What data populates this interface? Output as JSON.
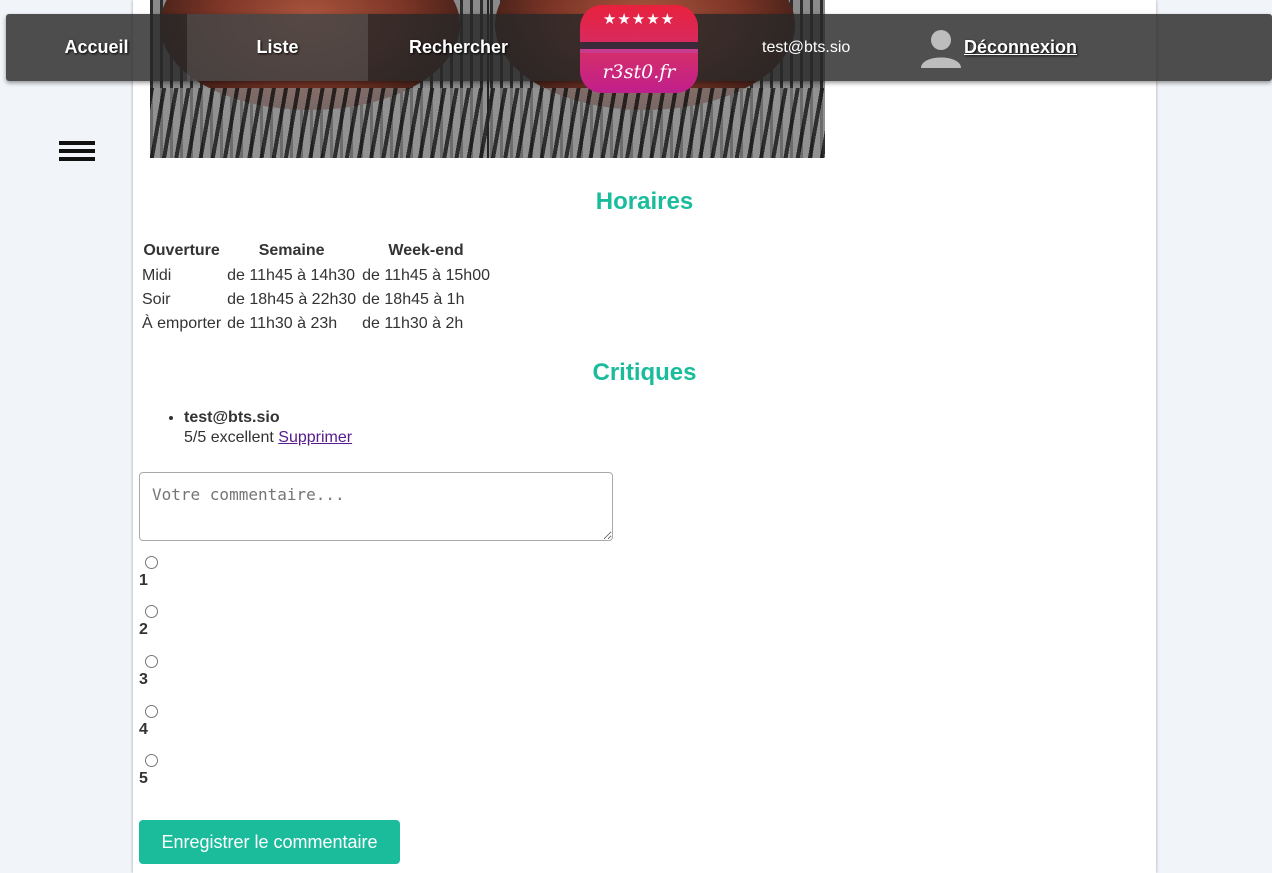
{
  "nav": {
    "home": "Accueil",
    "list": "Liste",
    "search": "Rechercher",
    "logo_stars": "★★★★★",
    "logo_text": "r3st0.fr",
    "user_email": "test@bts.sio",
    "logout": "Déconnexion"
  },
  "hours": {
    "title": "Horaires",
    "headers": [
      "Ouverture",
      "Semaine",
      "Week-end"
    ],
    "rows": [
      [
        "Midi",
        "de 11h45 à 14h30",
        "de 11h45 à 15h00"
      ],
      [
        "Soir",
        "de 18h45 à 22h30",
        "de 18h45 à 1h"
      ],
      [
        "À emporter",
        "de 11h30 à 23h",
        "de 11h30 à 2h"
      ]
    ]
  },
  "reviews": {
    "title": "Critiques",
    "items": [
      {
        "author": "test@bts.sio",
        "text": "5/5 excellent",
        "delete_label": "Supprimer"
      }
    ]
  },
  "form": {
    "comment_placeholder": "Votre commentaire...",
    "ratings": [
      "1",
      "2",
      "3",
      "4",
      "5"
    ],
    "save_label": "Enregistrer le commentaire"
  },
  "colors": {
    "accent": "#1abc9c",
    "navbar": "#282828"
  }
}
